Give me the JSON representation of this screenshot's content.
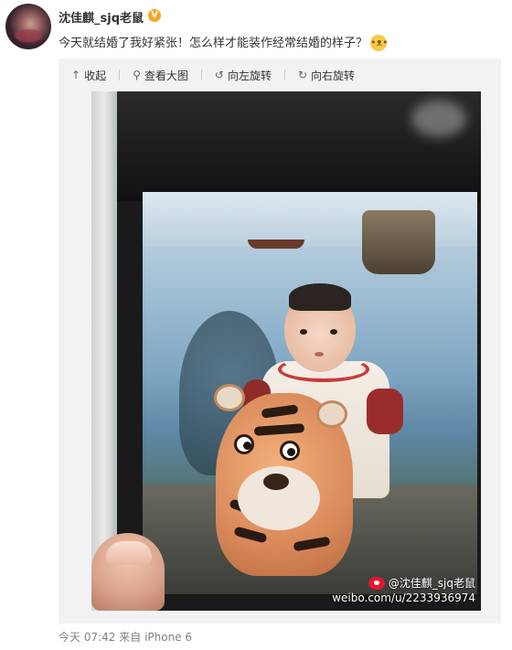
{
  "user": {
    "name": "沈佳麒_sjq老鼠",
    "verified_badge": "V"
  },
  "post": {
    "text": "今天就结婚了我好紧张！怎么样才能装作经常结婚的样子？",
    "emoji": "doge-emoji"
  },
  "toolbar": {
    "collapse_label": "收起",
    "view_large_label": "查看大图",
    "rotate_left_label": "向左旋转",
    "rotate_right_label": "向右旋转",
    "icons": {
      "collapse": "arrow-up-icon",
      "view_large": "magnifier-icon",
      "rotate_left": "rotate-left-icon",
      "rotate_right": "rotate-right-icon"
    }
  },
  "image": {
    "watermark_user": "@沈佳麒_sjq老鼠",
    "watermark_url": "weibo.com/u/2233936974"
  },
  "meta": {
    "time": "今天 07:42",
    "source_prefix": "来自",
    "source": "iPhone 6"
  },
  "colors": {
    "badge": "#f5a623",
    "text": "#333333",
    "meta": "#808080",
    "media_bg": "#f2f2f5"
  }
}
